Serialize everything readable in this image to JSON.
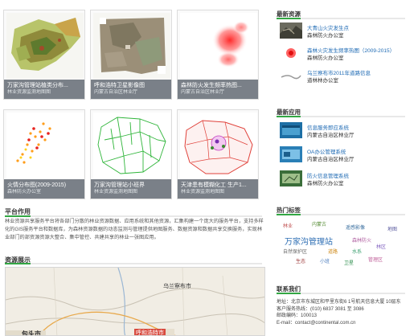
{
  "cards": [
    {
      "title": "万家沟管理站植类分布...",
      "sub": "林业资源监测地图图"
    },
    {
      "title": "呼和浩特卫星影像图",
      "sub": "内蒙古自治区林业厅"
    },
    {
      "title": "森林防火发生频率热图...",
      "sub": "内蒙古自治区林业厅"
    },
    {
      "title": "火情分布图(2009-2015)",
      "sub": "森林防火办公室"
    },
    {
      "title": "万家沟管理站小班界",
      "sub": "林业资源监测地图图"
    },
    {
      "title": "天津患有模糊化工 生产1...",
      "sub": "林业资源监测地图图"
    }
  ],
  "platform": {
    "title": "平台作用",
    "text": "林业资源共享服务平台将各部门分散的林业资源数据、应用系统和其他资源，汇集构建一个庞大的服务平台，支持多样化的GIS服务平台和数据库，为森林资源数据的动态监测与管理提供地图服务、数据资源和数据共享交换服务，实现林业部门的部资源资源大整合、集中管控、共建共享的林业一张图应用。"
  },
  "resource_show": {
    "title": "资源展示",
    "map_labels": [
      "乌兰察布市",
      "呼和浩特市",
      "包头市"
    ]
  },
  "sidebar": {
    "latest_resources_title": "最新资源",
    "latest_resources": [
      {
        "name": "大青山火灾发生点",
        "org": "森林防火办公室"
      },
      {
        "name": "森林火灾发生频率热图（2009-2015）",
        "org": "森林防火办公室"
      },
      {
        "name": "乌兰察布市2011年道路信息",
        "org": "道林林办公室"
      }
    ],
    "latest_apps_title": "最新应用",
    "latest_apps": [
      {
        "name": "信息服务即应系统",
        "org": "内蒙古自治区林业厅"
      },
      {
        "name": "OA办公管理系统",
        "org": "内蒙古自治区林业厅"
      },
      {
        "name": "防火信息管理系统",
        "org": "森林防火办公室"
      }
    ],
    "tags_title": "热门标签",
    "tags": [
      "林业",
      "内蒙古",
      "遥感影像",
      "万家沟管理站",
      "森林防火",
      "自然保护区",
      "道路",
      "水系",
      "林区",
      "生态",
      "小班",
      "卫星",
      "管理区",
      "地图"
    ],
    "contact_title": "联系我们",
    "contact": {
      "address": "地址：北京市东城区和平里东街6 1号航天信息大厦 10层东",
      "phone": "客户服务热线：(010) 6837 3081 至 3086",
      "postcode": "邮政编码：100013",
      "email": "E-mail：contact@continental.com.cn"
    }
  },
  "colors": {
    "accent": "#33a744",
    "link": "#1e6ab4",
    "caption_bg": "#7a8088"
  }
}
